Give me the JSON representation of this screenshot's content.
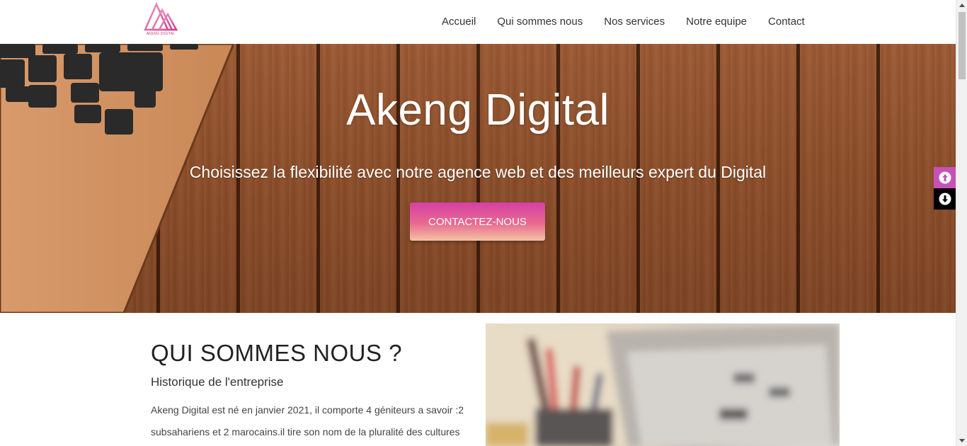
{
  "brand": {
    "logo_text": "AKENG DIGITAL",
    "accent": "#c652b7"
  },
  "nav": {
    "items": [
      "Accueil",
      "Qui sommes nous",
      "Nos services",
      "Notre equipe",
      "Contact"
    ]
  },
  "hero": {
    "title": "Akeng Digital",
    "subtitle": "Choisissez la flexibilité avec notre agence web et des meilleurs expert du Digital",
    "cta_label": "CONTACTEZ-NOUS"
  },
  "side_buttons": {
    "up_icon": "arrow-up-circle-icon",
    "down_icon": "arrow-down-circle-icon"
  },
  "about": {
    "title": "QUI SOMMES NOUS ?",
    "subtitle": "Historique de l'entreprise",
    "text": "Akeng Digital est né en janvier 2021, il comporte 4 géniteurs a savoir :2 subsahariens et 2 marocains.il tire son nom de la pluralité des cultures"
  }
}
